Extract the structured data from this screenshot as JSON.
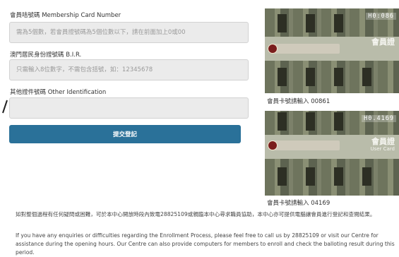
{
  "form": {
    "membership": {
      "label": "會員咭號碼 Membership Card Number",
      "placeholder": "需為5個數，若會員證號碼為5個位數以下，請在前面加上0或00"
    },
    "bir": {
      "label": "澳門居民身份證號碼 B.I.R.",
      "placeholder": "只需輸入8位數字，不需包含括號，如：12345678"
    },
    "other_id": {
      "label": "其他證件號碼 Other Identification",
      "placeholder": ""
    },
    "submit_label": "提交登記"
  },
  "cards": [
    {
      "number": "H0:086",
      "tag_main": "會員證",
      "tag_sub": "",
      "caption": "會員卡號請輸入 00861"
    },
    {
      "number": "H0.4169",
      "tag_main": "會員證",
      "tag_sub": "User Card",
      "caption": "會員卡號請輸入 04169"
    }
  ],
  "note": {
    "zh": "如對整個過程有任何疑問或困難，可於本中心開放時段內致電28825109或親臨本中心尋求職員協助，本中心亦可提供電腦讓會員進行登記和查閱結果。",
    "en": "If you have any enquiries or difficulties regarding the Enrollment Process, please feel free to call us by 28825109 or visit our Centre for assistance during the opening hours. Our Centre can also provide computers for members to enroll and check the balloting result during this period."
  },
  "colors": {
    "submit_bg": "#2a7199",
    "field_bg": "#ebebeb"
  }
}
